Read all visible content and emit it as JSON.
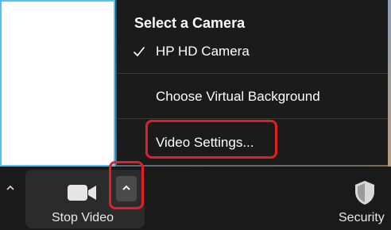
{
  "camera_menu": {
    "title": "Select a Camera",
    "cameras": [
      {
        "label": "HP HD Camera",
        "checked": true
      }
    ],
    "virtual_background_label": "Choose Virtual Background",
    "video_settings_label": "Video Settings..."
  },
  "toolbar": {
    "video_button_label": "Stop Video",
    "security_label": "Security"
  },
  "colors": {
    "highlight": "#e41e26",
    "menu_background": "#1b1b1b",
    "toolbar_background": "#1a1a1a",
    "selected_tile_border": "#4fc3f7"
  },
  "icons": {
    "camera": "video-camera-icon",
    "shield": "shield-icon",
    "check": "checkmark-icon",
    "caret": "chevron-up-icon"
  }
}
